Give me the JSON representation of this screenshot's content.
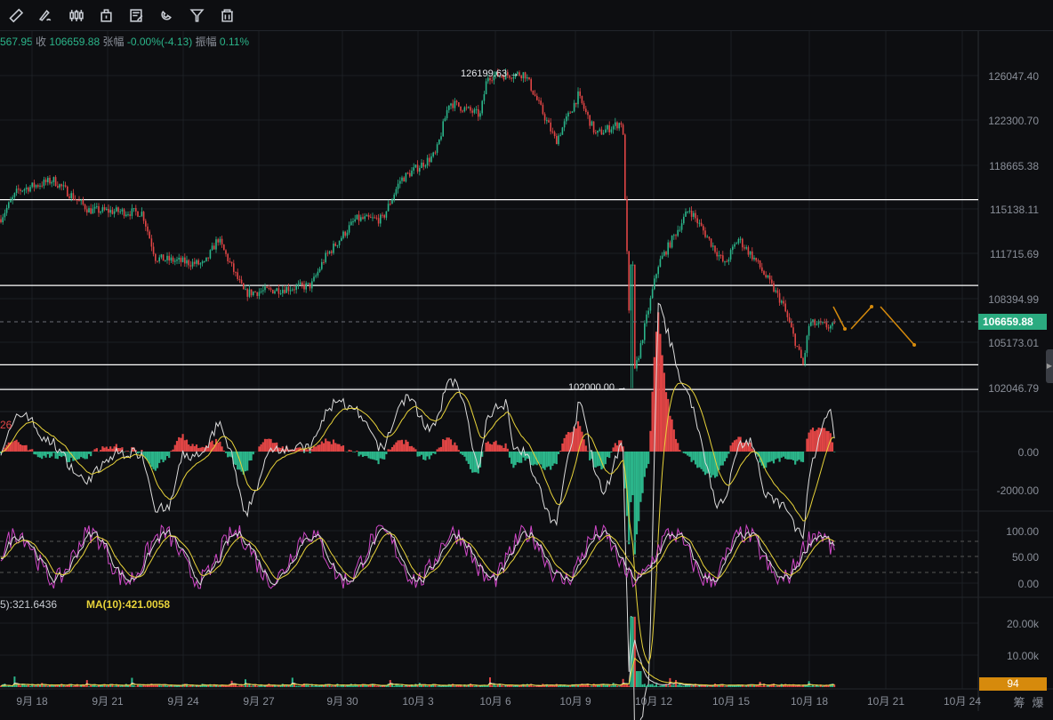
{
  "toolbar": {
    "tools": [
      "ruler-icon",
      "brush-icon",
      "candles-icon",
      "trash-lock-icon",
      "note-icon",
      "magnet-icon",
      "filter-icon",
      "delete-icon"
    ]
  },
  "infobar": {
    "open_partial": "567.95",
    "close_label": "收",
    "close_value": "106659.88",
    "change_label": "张幅",
    "change_value": "-0.00%(-4.13)",
    "amplitude_label": "振幅",
    "amplitude_value": "0.11%"
  },
  "price_axis": [
    "126047.40",
    "122300.70",
    "118665.38",
    "115138.11",
    "111715.69",
    "108394.99",
    "105173.01",
    "102046.79"
  ],
  "last_price": "106659.88",
  "annotations": {
    "high": "126199.63 →",
    "low": "102000.00 →"
  },
  "macd": {
    "label_partial": "26",
    "axis": [
      "0.00",
      "-2000.00"
    ]
  },
  "kdj": {
    "axis": [
      "100.00",
      "50.00",
      "0.00"
    ]
  },
  "volume": {
    "ma5": "5):321.6436",
    "ma10": "MA(10):421.0058",
    "axis": [
      "20.00k",
      "10.00k"
    ],
    "current": "94"
  },
  "dates": [
    "9月 18",
    "9月 21",
    "9月 24",
    "9月 27",
    "9月 30",
    "10月 3",
    "10月 6",
    "10月 9",
    "10月 12",
    "10月 15",
    "10月 18",
    "10月 21",
    "10月 24"
  ],
  "footer_buttons": [
    "筹",
    "爆"
  ],
  "colors": {
    "up": "#2bb58a",
    "down": "#e04545",
    "accent": "#d68a0c",
    "ma_yellow": "#e8d33a",
    "kdj_pink": "#d048c8"
  },
  "chart_data": {
    "type": "candlestick",
    "title": "",
    "price_path": [
      [
        "9月15",
        115000
      ],
      [
        "9月16",
        117200
      ],
      [
        "9月17",
        118000
      ],
      [
        "9月19",
        115700
      ],
      [
        "9月21",
        115500
      ],
      [
        "9月22",
        112000
      ],
      [
        "9月24",
        111500
      ],
      [
        "9月25",
        113500
      ],
      [
        "9月26",
        109300
      ],
      [
        "9月29",
        109900
      ],
      [
        "9月30",
        112000
      ],
      [
        "10月1",
        115000
      ],
      [
        "10月2",
        115000
      ],
      [
        "10月3",
        118000
      ],
      [
        "10月4",
        120000
      ],
      [
        "10月5",
        124000
      ],
      [
        "10月6",
        123000
      ],
      [
        "10月6b",
        126000
      ],
      [
        "10月7",
        126199.63
      ],
      [
        "10月8",
        121000
      ],
      [
        "10月9",
        124500
      ],
      [
        "10月10",
        121500
      ],
      [
        "10月11",
        122500
      ],
      [
        "10月11b",
        102000
      ],
      [
        "10月12",
        111500
      ],
      [
        "10月13",
        115800
      ],
      [
        "10月14",
        111500
      ],
      [
        "10月15",
        113500
      ],
      [
        "10月16",
        111800
      ],
      [
        "10月17",
        108500
      ],
      [
        "10月17b",
        103800
      ],
      [
        "10月18",
        107000
      ],
      [
        "10月19",
        106659.88
      ]
    ],
    "ylim": [
      101500,
      127000
    ],
    "horizontal_lines": [
      116500,
      109900,
      103800,
      101900
    ]
  }
}
